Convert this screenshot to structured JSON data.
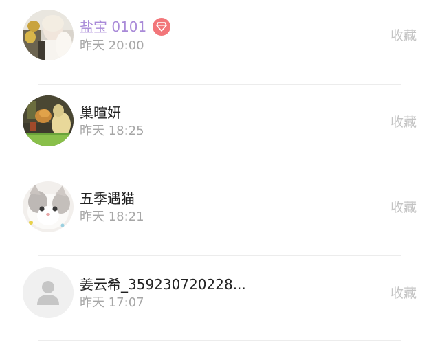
{
  "follow_list": {
    "items": [
      {
        "name": "盐宝 0101",
        "time": "昨天 20:00",
        "action": "收藏",
        "is_vip": true,
        "avatar_icon": "user-photo-avatar"
      },
      {
        "name": "巢暄妍",
        "time": "昨天 18:25",
        "action": "收藏",
        "is_vip": false,
        "avatar_icon": "user-photo-avatar"
      },
      {
        "name": "五季遇猫",
        "time": "昨天 18:21",
        "action": "收藏",
        "is_vip": false,
        "avatar_icon": "cat-photo-avatar"
      },
      {
        "name": "姜云希_359230720228...",
        "time": "昨天 17:07",
        "action": "收藏",
        "is_vip": false,
        "avatar_icon": "default-user-icon"
      }
    ]
  },
  "colors": {
    "vip_name": "#a98ad8",
    "vip_badge": "#f2767a",
    "name": "#222222",
    "time": "#a6a6a6",
    "action": "#c4c4c4",
    "divider": "#ececec"
  },
  "icons": {
    "vip_badge": "diamond-icon"
  }
}
